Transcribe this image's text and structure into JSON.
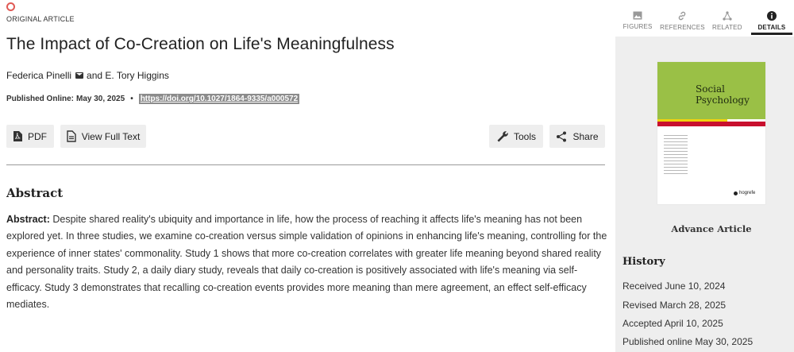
{
  "article": {
    "type_label": "ORIGINAL ARTICLE",
    "title": "The Impact of Co-Creation on Life's Meaningfulness",
    "author_1": "Federica Pinelli",
    "author_connector": "and",
    "author_2": "E. Tory Higgins",
    "published_label": "Published Online:",
    "published_date": "May 30, 2025",
    "separator": "•",
    "doi": "https://doi.org/10.1027/1864-9335/a000572",
    "open_access_color": "#e05a55"
  },
  "actions": {
    "pdf_label": "PDF",
    "full_text_label": "View Full Text",
    "tools_label": "Tools",
    "share_label": "Share"
  },
  "abstract": {
    "heading": "Abstract",
    "lead": "Abstract:",
    "text": "Despite shared reality's ubiquity and importance in life, how the process of reaching it affects life's meaning has not been explored yet. In three studies, we examine co-creation versus simple validation of opinions in enhancing life's meaning, controlling for the experience of inner states' commonality. Study 1 shows that more co-creation correlates with greater life meaning beyond shared reality and personality traits. Study 2, a daily diary study, reveals that daily co-creation is positively associated with life's meaning via self-efficacy. Study 3 demonstrates that recalling co-creation events provides more meaning than mere agreement, an effect self-efficacy mediates."
  },
  "sidebar": {
    "tabs": [
      {
        "label": "FIGURES",
        "icon": "image-icon",
        "active": false
      },
      {
        "label": "REFERENCES",
        "icon": "link-icon",
        "active": false
      },
      {
        "label": "RELATED",
        "icon": "network-icon",
        "active": false
      },
      {
        "label": "DETAILS",
        "icon": "info-icon",
        "active": true
      }
    ],
    "cover": {
      "journal_title_line1": "Social",
      "journal_title_line2": "Psychology",
      "publisher": "hogrefe",
      "accent_green": "#9ac046",
      "accent_red": "#c8102e",
      "accent_yellow": "#f1d20e"
    },
    "status": "Advance Article",
    "history": {
      "heading": "History",
      "items": [
        "Received June 10, 2024",
        "Revised March 28, 2025",
        "Accepted April 10, 2025",
        "Published online May 30, 2025"
      ]
    }
  }
}
